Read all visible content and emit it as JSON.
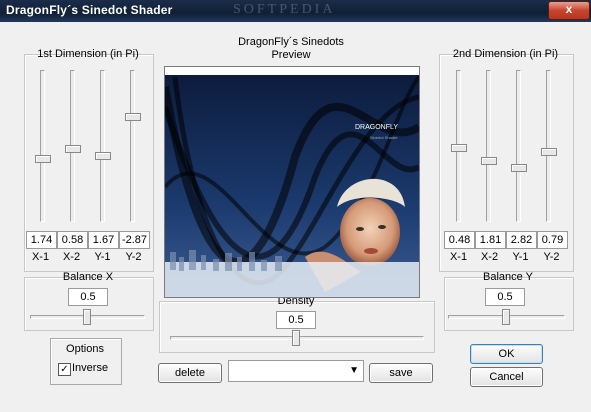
{
  "window": {
    "title": "DragonFly´s Sinedot Shader",
    "watermark": "SOFTPEDIA",
    "close_label": "x"
  },
  "header": {
    "line1": "DragonFly´s Sinedots",
    "line2": "Preview"
  },
  "dim1": {
    "title": "1st Dimension (in Pi)",
    "sliders": [
      {
        "label": "X-1",
        "value": "1.74",
        "level": 0.4
      },
      {
        "label": "X-2",
        "value": "0.58",
        "level": 0.47
      },
      {
        "label": "Y-1",
        "value": "1.67",
        "level": 0.42
      },
      {
        "label": "Y-2",
        "value": "-2.87",
        "level": 0.7
      }
    ]
  },
  "dim2": {
    "title": "2nd Dimension (in Pi)",
    "sliders": [
      {
        "label": "X-1",
        "value": "0.48",
        "level": 0.48
      },
      {
        "label": "X-2",
        "value": "1.81",
        "level": 0.39
      },
      {
        "label": "Y-1",
        "value": "2.82",
        "level": 0.34
      },
      {
        "label": "Y-2",
        "value": "0.79",
        "level": 0.45
      }
    ]
  },
  "balance_x": {
    "title": "Balance X",
    "value": "0.5",
    "level": 0.5
  },
  "balance_y": {
    "title": "Balance Y",
    "value": "0.5",
    "level": 0.5
  },
  "density": {
    "title": "Density",
    "value": "0.5",
    "level": 0.5
  },
  "options": {
    "title": "Options",
    "inverse_label": "Inverse",
    "inverse_checked": true
  },
  "buttons": {
    "ok": "OK",
    "cancel": "Cancel",
    "delete": "delete",
    "save": "save"
  },
  "preset_combo": {
    "value": ""
  },
  "preview_image_text": {
    "line1": "DRAGONFLY",
    "line2": "Sinedot Shader"
  },
  "colors": {
    "titlebar": "#1a2d4a",
    "window_bg": "#f0f0f0",
    "close": "#c7442e"
  }
}
